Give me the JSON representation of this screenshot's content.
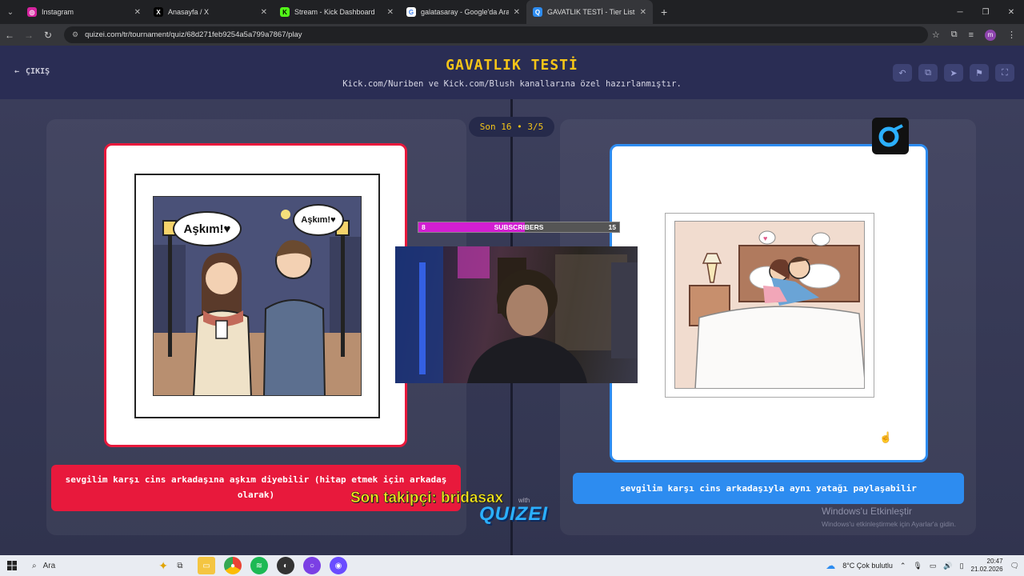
{
  "browser": {
    "tabs": [
      {
        "title": "Instagram",
        "favicon_color": "#d6249f",
        "favicon_glyph": "◎"
      },
      {
        "title": "Anasayfa / X",
        "favicon_color": "#000000",
        "favicon_glyph": "X"
      },
      {
        "title": "Stream - Kick Dashboard",
        "favicon_color": "#53fc18",
        "favicon_glyph": "K"
      },
      {
        "title": "galatasaray - Google'da Ara",
        "favicon_color": "#4285f4",
        "favicon_glyph": "G"
      },
      {
        "title": "GAVATLIK TESTİ - Tier List, Kör T",
        "favicon_color": "#2d8cf0",
        "favicon_glyph": "Q"
      }
    ],
    "active_tab": 4,
    "url": "quizei.com/tr/tournament/quiz/68d271feb9254a5a799a7867/play"
  },
  "quiz": {
    "exit_label": "ÇIKIŞ",
    "title": "GAVATLIK TESTİ",
    "subtitle": "Kick.com/Nuriben ve Kick.com/Blush kanallarına özel hazırlanmıştır.",
    "round": "Son 16 • 3/5",
    "left_option": {
      "label": "sevgilim karşı cins arkadaşına aşkım diyebilir (hitap etmek için arkadaş olarak)",
      "bubble_1": "Aşkım!♥",
      "bubble_2": "Aşkım!♥",
      "accent": "#e8193c"
    },
    "right_option": {
      "label": "sevgilim karşı cins arkadaşıyla aynı yatağı paylaşabilir",
      "accent": "#2d8cf0"
    }
  },
  "overlay": {
    "sub_left": "8",
    "sub_label": "SUBSCRIBERS",
    "sub_right": "15",
    "sub_progress": 0.53,
    "last_follower": "Son takipçi: bridasax",
    "with_text": "with",
    "brand": "QUIZEI"
  },
  "system": {
    "watermark_title": "Windows'u Etkinleştir",
    "watermark_sub": "Windows'u etkinleştirmek için Ayarlar'a gidin.",
    "search_placeholder": "Ara",
    "weather": "8°C  Çok bulutlu",
    "time": "20:47",
    "date": "21.02.2026"
  }
}
